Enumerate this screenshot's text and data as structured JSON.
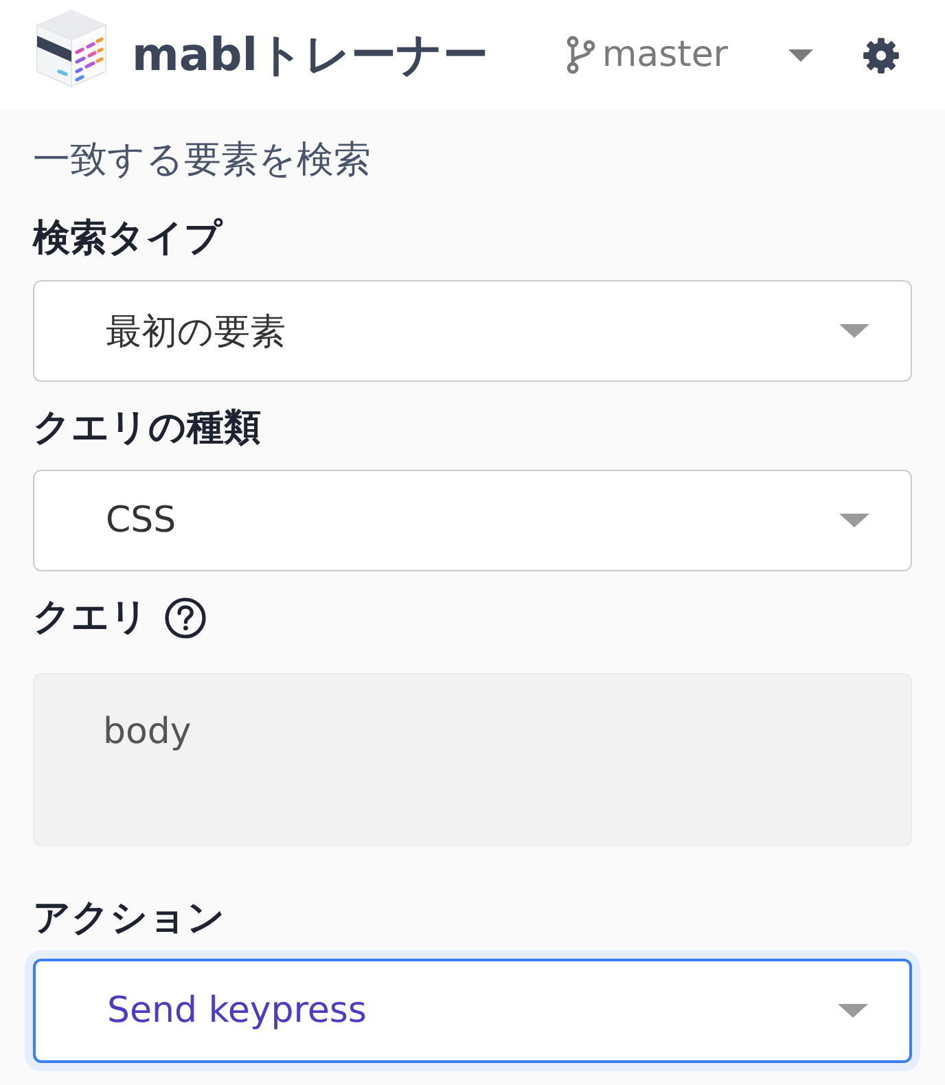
{
  "header": {
    "title": "mablトレーナー",
    "branch": "master"
  },
  "section_title": "一致する要素を検索",
  "fields": [
    {
      "kind": "select",
      "label": "検索タイプ",
      "value": "最初の要素",
      "focused": false
    },
    {
      "kind": "select",
      "label": "クエリの種類",
      "value": "CSS",
      "focused": false
    },
    {
      "kind": "textarea",
      "label": "クエリ",
      "help": true,
      "value": "body",
      "disabled": true
    },
    {
      "kind": "select",
      "label": "アクション",
      "value": "Send keypress",
      "focused": true
    }
  ]
}
